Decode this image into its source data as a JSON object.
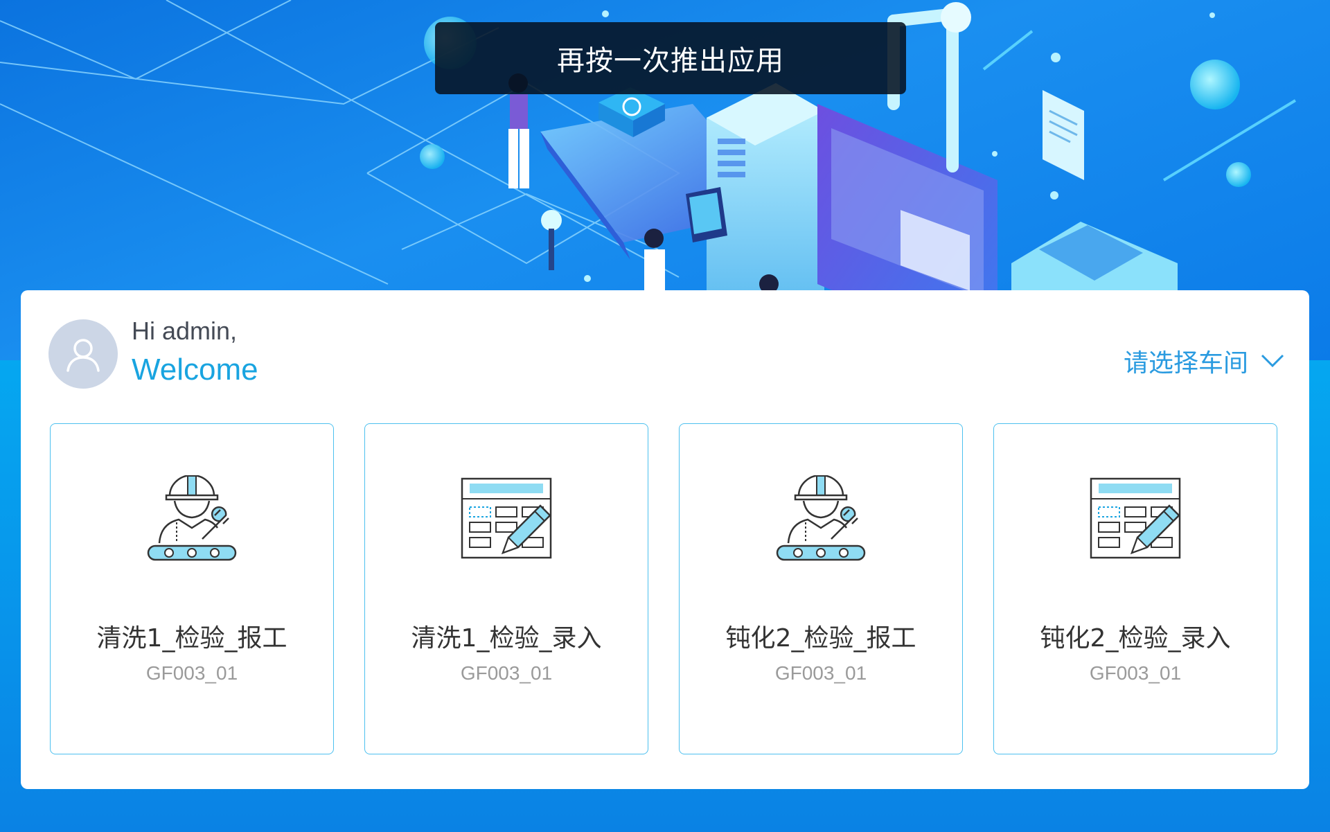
{
  "toast": {
    "text": "再按一次推出应用"
  },
  "user": {
    "greeting": "Hi admin,",
    "welcome": "Welcome"
  },
  "workshop_select": {
    "label": "请选择车间"
  },
  "tiles": [
    {
      "title": "清洗1_检验_报工",
      "code": "GF003_01",
      "icon": "worker-conveyor-icon"
    },
    {
      "title": "清洗1_检验_录入",
      "code": "GF003_01",
      "icon": "form-edit-icon"
    },
    {
      "title": "钝化2_检验_报工",
      "code": "GF003_01",
      "icon": "worker-conveyor-icon"
    },
    {
      "title": "钝化2_检验_录入",
      "code": "GF003_01",
      "icon": "form-edit-icon"
    }
  ],
  "colors": {
    "accent": "#19a4e0",
    "tile_border": "#4cc0ef",
    "banner_blue": "#0b7be8",
    "icon_fill": "#8fdcf3"
  }
}
